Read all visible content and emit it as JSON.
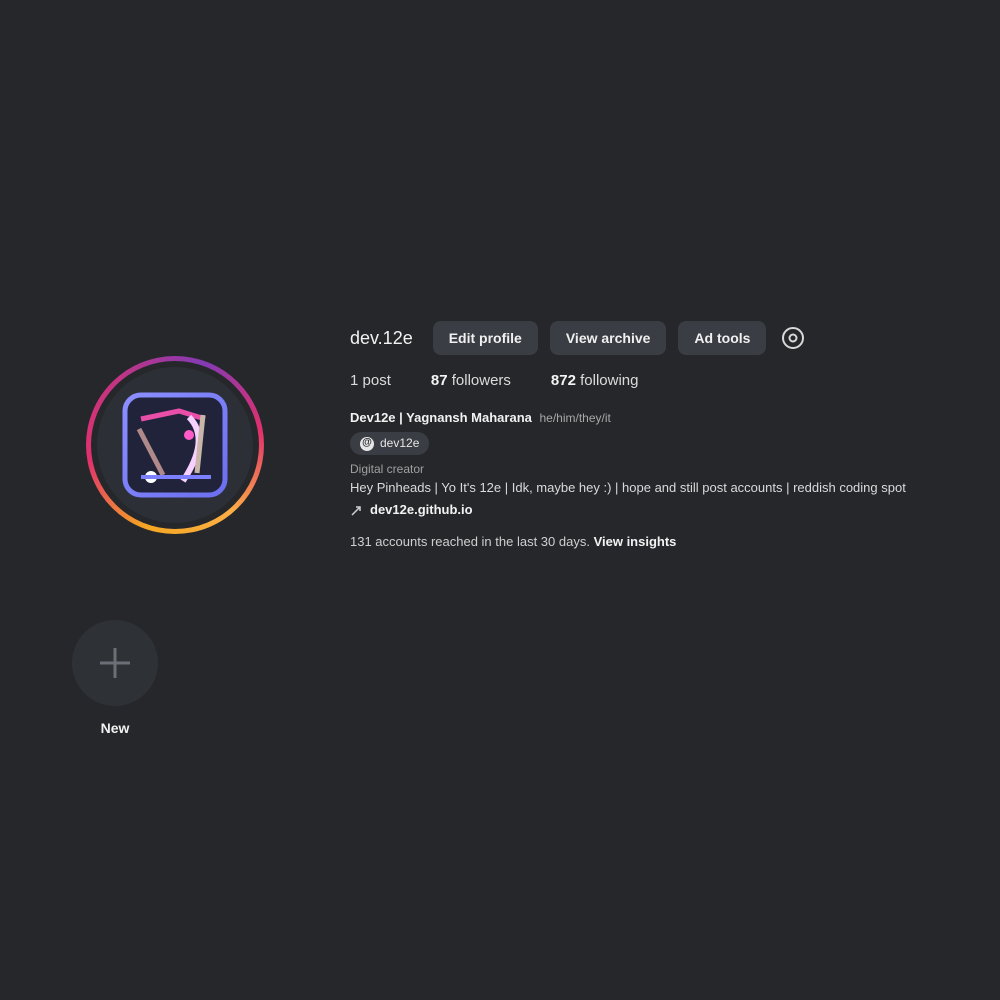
{
  "profile": {
    "username": "dev.12e",
    "avatar_icon": "profile-logo",
    "buttons": {
      "edit_profile": "Edit profile",
      "view_archive": "View archive",
      "ad_tools": "Ad tools"
    },
    "stats": {
      "posts_label": "1 post",
      "followers_count": "87",
      "followers_label": "followers",
      "following_count": "872",
      "following_label": "following"
    },
    "bio": {
      "name": "Dev12e | Yagnansh Maharana",
      "pronouns": "he/him/they/it",
      "threads_badge": "dev12e",
      "category": "Digital creator",
      "text": "Hey Pinheads | Yo It's 12e | Idk, maybe hey :) | hope and still post accounts | reddish coding spot",
      "link": "dev12e.github.io"
    },
    "insights": {
      "text": "131 accounts reached in the last 30 days.",
      "link": "View insights"
    }
  },
  "highlights": {
    "new_label": "New"
  },
  "colors": {
    "background": "#25272b",
    "button": "#3a3d43",
    "ring_start": "#f5a623",
    "ring_end": "#c13584"
  }
}
